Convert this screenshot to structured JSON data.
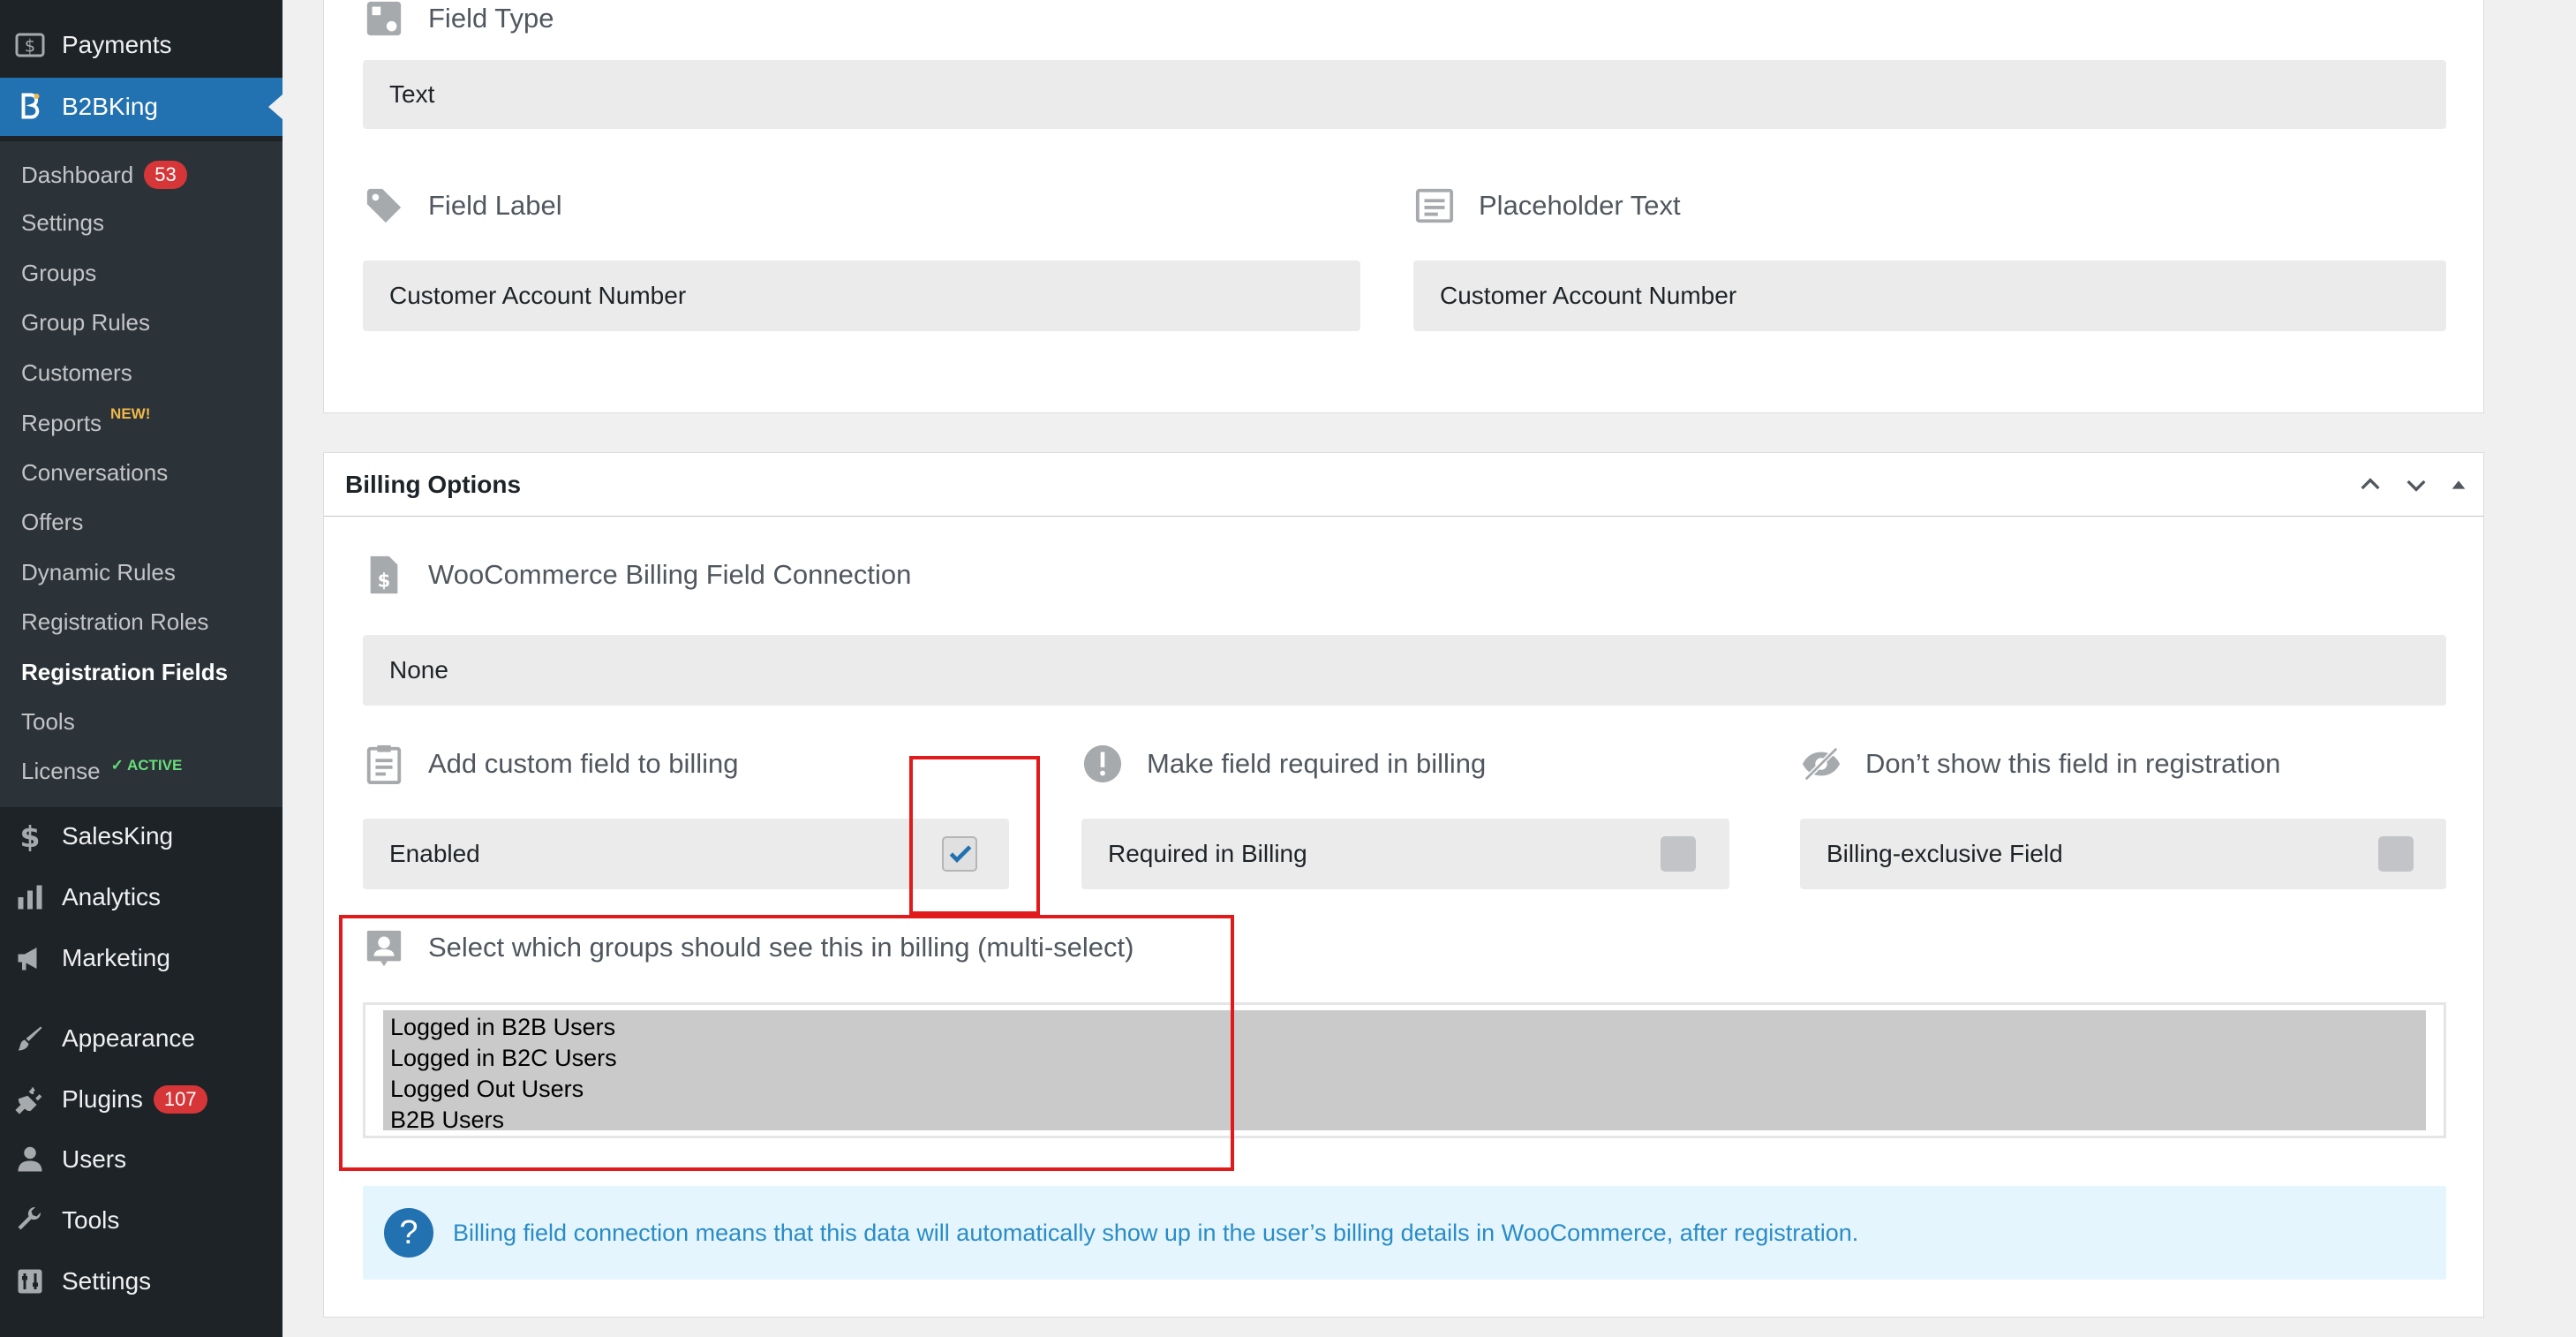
{
  "sidebar": {
    "top_items": [
      {
        "label": "Payments",
        "icon": "payments-icon"
      },
      {
        "label": "B2BKing",
        "icon": "b2bking-icon"
      }
    ],
    "submenu": [
      {
        "label": "Dashboard",
        "badge": "53"
      },
      {
        "label": "Settings"
      },
      {
        "label": "Groups"
      },
      {
        "label": "Group Rules"
      },
      {
        "label": "Customers"
      },
      {
        "label": "Reports",
        "tag": "NEW!"
      },
      {
        "label": "Conversations"
      },
      {
        "label": "Offers"
      },
      {
        "label": "Dynamic Rules"
      },
      {
        "label": "Registration Roles"
      },
      {
        "label": "Registration Fields"
      },
      {
        "label": "Tools"
      },
      {
        "label": "License",
        "tag": "✓ ACTIVE"
      }
    ],
    "bottom_items": [
      {
        "label": "SalesKing"
      },
      {
        "label": "Analytics"
      },
      {
        "label": "Marketing"
      },
      {
        "label": "Appearance"
      },
      {
        "label": "Plugins",
        "badge": "107"
      },
      {
        "label": "Users"
      },
      {
        "label": "Tools"
      },
      {
        "label": "Settings"
      }
    ]
  },
  "field_panel": {
    "field_type_label": "Field Type",
    "field_type_value": "Text",
    "field_label_label": "Field Label",
    "field_label_value": "Customer Account Number",
    "placeholder_label": "Placeholder Text",
    "placeholder_value": "Customer Account Number"
  },
  "billing": {
    "title": "Billing Options",
    "connection_label": "WooCommerce Billing Field Connection",
    "connection_value": "None",
    "add_to_billing_label": "Add custom field to billing",
    "add_to_billing_value": "Enabled",
    "add_to_billing_checked": true,
    "required_label": "Make field required in billing",
    "required_value": "Required in Billing",
    "required_checked": false,
    "hide_label": "Don’t show this field in registration",
    "hide_value": "Billing-exclusive Field",
    "hide_checked": false,
    "groups_label": "Select which groups should see this in billing (multi-select)",
    "groups_options": [
      "Logged in B2B Users",
      "Logged in B2C Users",
      "Logged Out Users",
      "B2B Users"
    ],
    "notice": "Billing field connection means that this data will automatically show up in the user’s billing details in WooCommerce, after registration."
  },
  "colors": {
    "sidebar_bg": "#1d2327",
    "submenu_bg": "#2c3338",
    "accent": "#2271b1",
    "badge": "#d63638",
    "highlight": "#e11b1b",
    "notice_bg": "#e5f5fd"
  }
}
